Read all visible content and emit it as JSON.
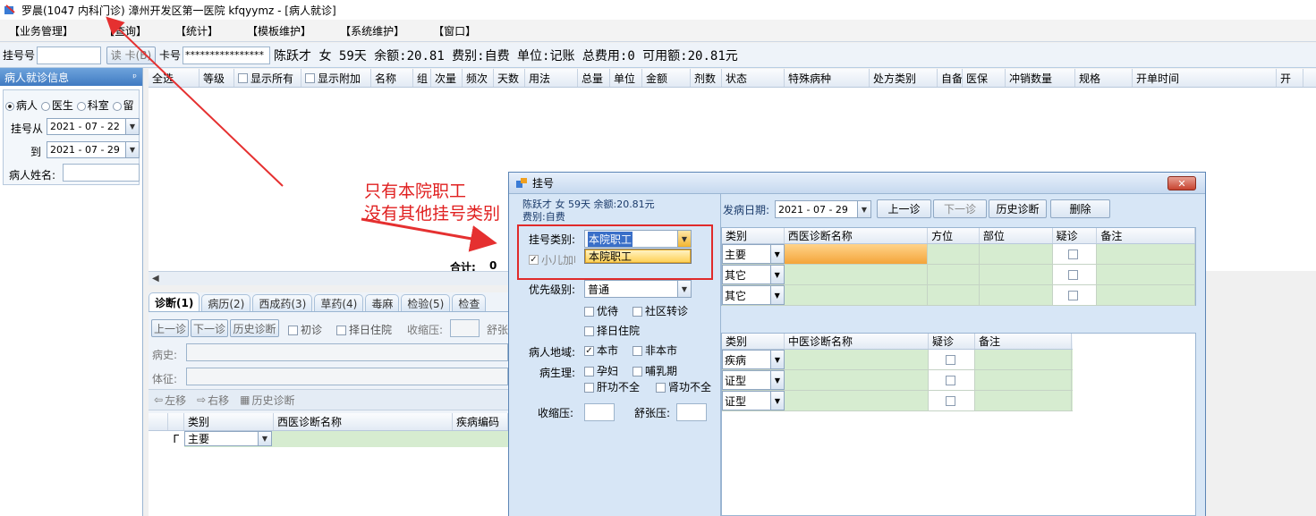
{
  "window": {
    "title": "罗晨(1047 内科门诊) 漳州开发区第一医院 kfqyymz - [病人就诊]"
  },
  "menu": [
    "【业务管理】",
    "【查询】",
    "【统计】",
    "【模板维护】",
    "【系统维护】",
    "【窗口】"
  ],
  "toolbar": {
    "reg_label": "挂号号",
    "read_card_label": "读 卡(B)",
    "card_label": "卡号",
    "card_value": "****************",
    "patient_info": "陈跃才 女 59天 余额:20.81 费别:自费 单位:记账 总费用:0 可用额:20.81元"
  },
  "left_panel": {
    "title": "病人就诊信息",
    "pin": "ᵖ",
    "radio_options": [
      "病人",
      "医生",
      "科室",
      "留"
    ],
    "from_label": "挂号从",
    "from_date": "2021 - 07 - 22",
    "to_label": "到",
    "to_date": "2021 - 07 - 29",
    "name_label": "病人姓名:"
  },
  "grid_headers": [
    "全选",
    "等级",
    "显示所有",
    "显示附加",
    "名称",
    "组",
    "次量",
    "频次",
    "天数",
    "用法",
    "总量",
    "单位",
    "金额",
    "剂数",
    "状态",
    "特殊病种",
    "处方类别",
    "自备",
    "医保",
    "冲销数量",
    "规格",
    "开单时间",
    "开"
  ],
  "total_label": "合计:",
  "total_value": "0",
  "tabs": [
    "诊断(1)",
    "病历(2)",
    "西成药(3)",
    "草药(4)",
    "毒麻",
    "检验(5)",
    "检查"
  ],
  "diag_toolbar": {
    "prev": "上一诊",
    "next": "下一诊",
    "history": "历史诊断",
    "first": "初诊",
    "select_day": "择日住院",
    "systolic": "收缩压:",
    "diastolic": "舒张"
  },
  "history_label": "病史:",
  "sign_label": "体征:",
  "move_toolbar": {
    "left": "左移",
    "right": "右移",
    "history": "历史诊断"
  },
  "lower_grid": {
    "headers": [
      "类别",
      "西医诊断名称",
      "疾病编码"
    ],
    "row_type": "主要"
  },
  "dialog": {
    "title": "挂号",
    "close": "✕",
    "patient_line1": "陈跃才 女 59天 余额:20.81元",
    "patient_line2": "费别:自费",
    "reg_type_label": "挂号类别:",
    "reg_type_value": "本院职工",
    "dropdown_options": [
      "本院职工"
    ],
    "child_label": "小儿加收",
    "priority_label": "优先级别:",
    "priority_value": "普通",
    "priority_chk": "优待",
    "community_chk": "社区转诊",
    "select_day_chk": "择日住院",
    "region_label": "病人地域:",
    "region_local": "本市",
    "region_nonlocal": "非本市",
    "physio_label": "病生理:",
    "pregnant": "孕妇",
    "lactation": "哺乳期",
    "liver": "肝功不全",
    "kidney": "肾功不全",
    "systolic": "收缩压:",
    "diastolic": "舒张压:",
    "onset_label": "发病日期:",
    "onset_date": "2021 - 07 - 29",
    "btn_prev": "上一诊",
    "btn_next": "下一诊",
    "btn_history": "历史诊断",
    "btn_delete": "删除",
    "west_headers": [
      "类别",
      "西医诊断名称",
      "方位",
      "部位",
      "疑诊",
      "备注"
    ],
    "west_rows": [
      "主要",
      "其它",
      "其它"
    ],
    "tcm_headers": [
      "类别",
      "中医诊断名称",
      "疑诊",
      "备注"
    ],
    "tcm_rows": [
      "疾病",
      "证型",
      "证型"
    ]
  },
  "annotation": {
    "line1": "只有本院职工",
    "line2": "没有其他挂号类别"
  }
}
